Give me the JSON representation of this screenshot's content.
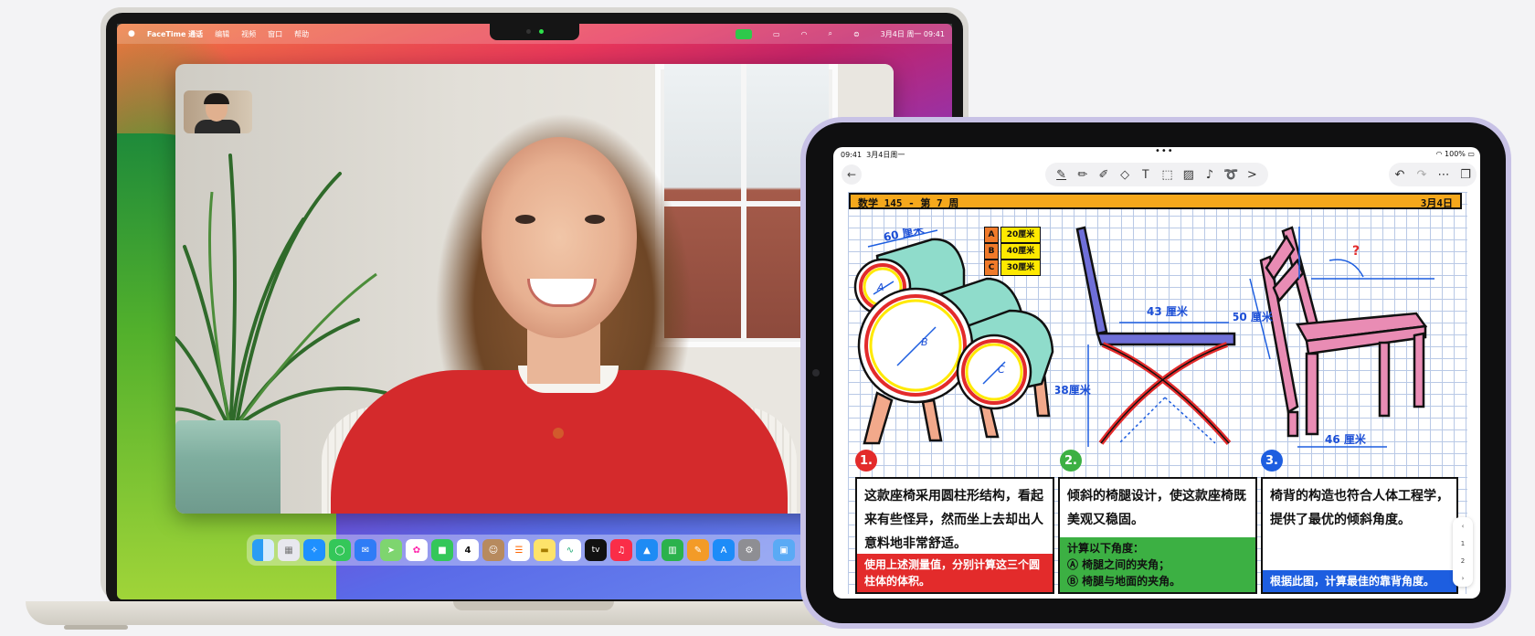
{
  "mac": {
    "menubar": {
      "apple": "",
      "app_name": "FaceTime 通话",
      "menus": [
        "编辑",
        "视频",
        "窗口",
        "帮助"
      ],
      "datetime": "3月4日 周一 09:41"
    },
    "dock_apps": [
      "finder",
      "launchpad",
      "safari",
      "messages",
      "mail",
      "maps",
      "photos",
      "facetime",
      "calendar",
      "contacts",
      "reminders",
      "notes",
      "freeform",
      "tv",
      "music",
      "keynote",
      "numbers",
      "pages",
      "app-store",
      "settings",
      "downloads"
    ],
    "calendar_day": "4",
    "tv_label": "tv"
  },
  "ipad": {
    "status": {
      "time": "09:41",
      "date": "3月4日周一",
      "battery": "100%",
      "dots": "•••"
    },
    "toolbar": {
      "back": "←",
      "more": ">",
      "undo": "↶",
      "redo": "↷",
      "menu": "⋯"
    },
    "note": {
      "title": "数学 145 - 第 7 周",
      "date": "3月4日",
      "legend": [
        {
          "key": "A",
          "value": "20厘米"
        },
        {
          "key": "B",
          "value": "40厘米"
        },
        {
          "key": "C",
          "value": "30厘米"
        }
      ],
      "dims": {
        "d60": "60 厘米",
        "d43": "43 厘米",
        "d50": "50 厘米",
        "d38": "38厘米",
        "d46": "46 厘米",
        "q": "?",
        "A": "A",
        "B": "B",
        "C": "C"
      },
      "cards": [
        {
          "num": "1.",
          "text": "这款座椅采用圆柱形结构，看起来有些怪异，然而坐上去却出人意料地非常舒适。",
          "footer": "使用上述测量值，分别计算这三个圆柱体的体积。"
        },
        {
          "num": "2.",
          "text": "倾斜的椅腿设计，使这款座椅既美观又稳固。",
          "footer_title": "计算以下角度：",
          "footer_a": "Ⓐ 椅腿之间的夹角；",
          "footer_b": "Ⓑ 椅腿与地面的夹角。"
        },
        {
          "num": "3.",
          "text": "椅背的构造也符合人体工程学，提供了最优的倾斜角度。",
          "footer": "根据此图，计算最佳的靠背角度。"
        }
      ],
      "page_indicator": [
        "1",
        "2"
      ]
    }
  },
  "colors": {
    "orange": "#f5a81c",
    "yellow": "#ffe900",
    "red": "#e32b2b",
    "green": "#3cb043",
    "blue": "#1d5ee0",
    "teal": "#8fdccb",
    "purple": "#6f6fd8",
    "pink": "#e98cb4"
  }
}
